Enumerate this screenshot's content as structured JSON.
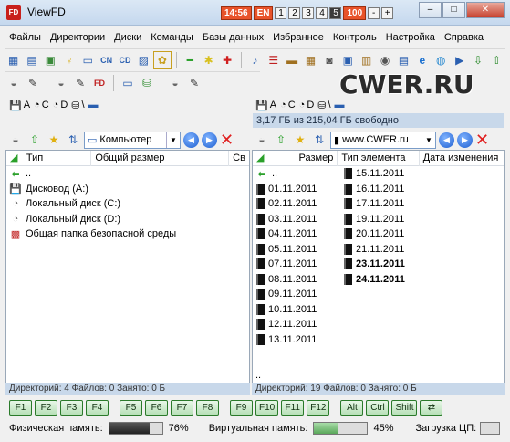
{
  "window": {
    "title": "ViewFD",
    "clock": "14:56",
    "lang": "EN",
    "desktops": [
      "1",
      "2",
      "3",
      "4",
      "5"
    ],
    "active_desktop_index": 4,
    "percent": "100",
    "minus": "-",
    "plus": "+"
  },
  "menu": [
    "Файлы",
    "Директории",
    "Диски",
    "Команды",
    "Базы данных",
    "Избранное",
    "Контроль",
    "Настройка",
    "Справка"
  ],
  "watermark": "CWER.RU",
  "left": {
    "drives": [
      {
        "icon": "hdd-icon",
        "label": "A"
      },
      {
        "icon": "cd-icon",
        "label": "C"
      },
      {
        "icon": "cd-icon",
        "label": "D"
      },
      {
        "icon": "network-icon",
        "label": "\\"
      }
    ],
    "location": "Компьютер",
    "columns": [
      "Тип",
      "Общий размер",
      "Св"
    ],
    "items": [
      {
        "icon": "up-arrow",
        "label": ".."
      },
      {
        "icon": "floppy-icon",
        "label": "Дисковод (A:)"
      },
      {
        "icon": "disk-icon",
        "label": "Локальный диск (C:)"
      },
      {
        "icon": "disk-icon",
        "label": "Локальный диск (D:)"
      },
      {
        "icon": "shared-folder-icon",
        "label": "Общая папка безопасной среды"
      }
    ],
    "status": "Директорий: 4  Файлов: 0  Занято: 0 Б"
  },
  "right": {
    "drives": [
      {
        "icon": "hdd-icon",
        "label": "A"
      },
      {
        "icon": "cd-icon",
        "label": "C"
      },
      {
        "icon": "cd-icon",
        "label": "D"
      },
      {
        "icon": "network-icon",
        "label": "\\"
      }
    ],
    "free_space": "3,17 ГБ из 215,04 ГБ свободно",
    "location": "www.CWER.ru",
    "columns": [
      "Размер",
      "Тип элемента",
      "Дата изменения"
    ],
    "col1": [
      "..",
      "01.11.2011",
      "02.11.2011",
      "03.11.2011",
      "04.11.2011",
      "05.11.2011",
      "07.11.2011",
      "08.11.2011",
      "09.11.2011",
      "10.11.2011",
      "12.11.2011",
      "13.11.2011"
    ],
    "col2": [
      "15.11.2011",
      "16.11.2011",
      "17.11.2011",
      "19.11.2011",
      "20.11.2011",
      "21.11.2011",
      "23.11.2011",
      "24.11.2011"
    ],
    "col2_bold": [
      false,
      false,
      false,
      false,
      false,
      false,
      true,
      true
    ],
    "below_path": "..",
    "status": "Директорий: 19  Файлов: 0  Занято: 0 Б"
  },
  "fkeys": {
    "group1": [
      "F1",
      "F2",
      "F3",
      "F4"
    ],
    "group2": [
      "F5",
      "F6",
      "F7",
      "F8"
    ],
    "group3": [
      "F9",
      "F10",
      "F11",
      "F12"
    ],
    "group4": [
      "Alt",
      "Ctrl",
      "Shift",
      "⇄"
    ]
  },
  "meters": {
    "phys_label": "Физическая память:",
    "phys_value": "76%",
    "phys_fraction": 0.76,
    "virt_label": "Виртуальная память:",
    "virt_value": "45%",
    "virt_fraction": 0.45,
    "cpu_label": "Загрузка ЦП:"
  }
}
